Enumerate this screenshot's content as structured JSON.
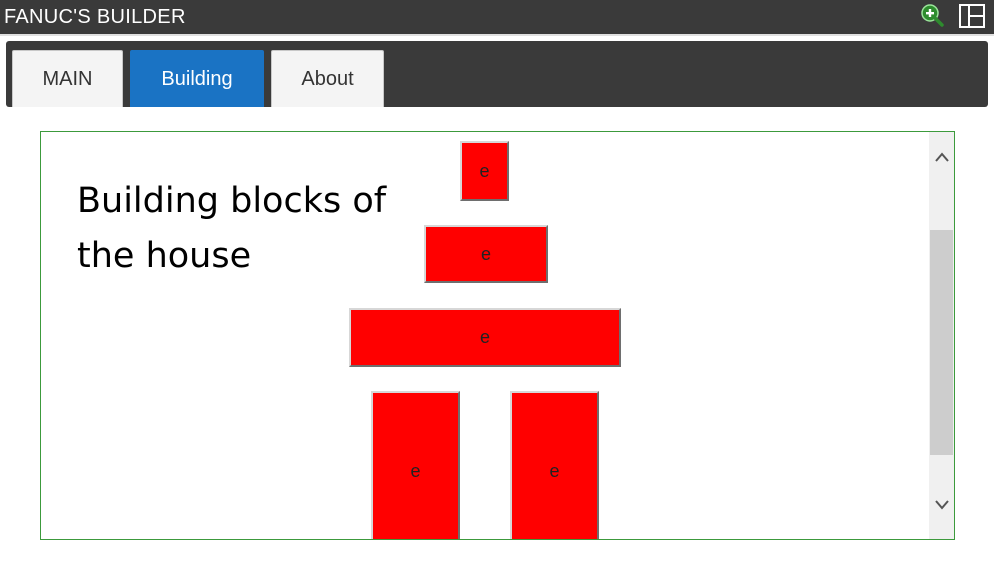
{
  "app": {
    "title": "FANUC'S BUILDER"
  },
  "titlebar_icons": [
    "zoom-in-icon",
    "layout-panel-icon"
  ],
  "tabs": [
    {
      "label": "MAIN",
      "active": false
    },
    {
      "label": "Building",
      "active": true
    },
    {
      "label": "About",
      "active": false
    }
  ],
  "content": {
    "heading": "Building blocks of the house",
    "blocks": [
      {
        "label": "e"
      },
      {
        "label": "e"
      },
      {
        "label": "e"
      },
      {
        "label": "e"
      },
      {
        "label": "e"
      }
    ]
  },
  "colors": {
    "titlebar_bg": "#3a3a3a",
    "active_tab": "#1a73c4",
    "block_fill": "#ff0000",
    "panel_border": "#3c9a3c"
  }
}
